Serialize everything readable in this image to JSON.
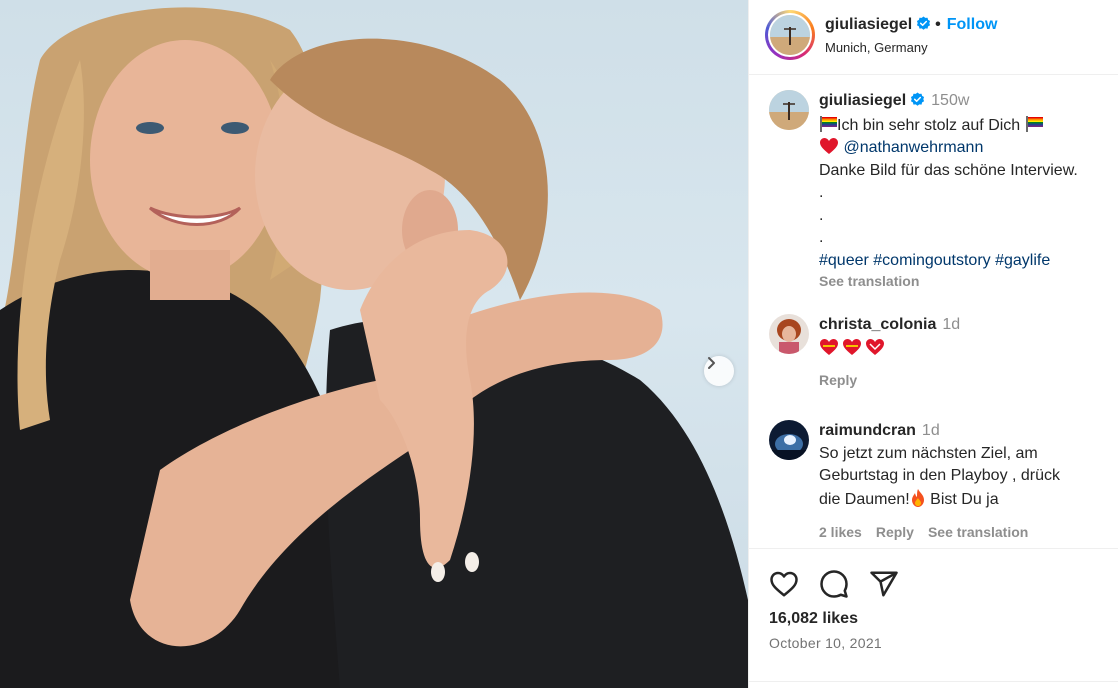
{
  "post": {
    "username": "giuliasiegel",
    "location": "Munich, Germany",
    "follow_label": "Follow",
    "separator": "•"
  },
  "caption": {
    "username": "giuliasiegel",
    "time": "150w",
    "line1": "Ich bin sehr stolz auf Dich",
    "mention": "@nathanwehrmann",
    "line3": "Danke Bild für das schöne Interview.",
    "dots": [
      ".",
      ".",
      "."
    ],
    "hashtags": "#queer #comingoutstory #gaylife",
    "see_translation": "See translation"
  },
  "comments": [
    {
      "username": "christa_colonia",
      "time": "1d",
      "reply_label": "Reply"
    },
    {
      "username": "raimundcran",
      "time": "1d",
      "text_lines": [
        "So jetzt zum nächsten Ziel, am",
        "Geburtstag in den Playboy , drück",
        "die Daumen!"
      ],
      "text_after_emoji": " Bist Du ja",
      "likes_label": "2 likes",
      "reply_label": "Reply",
      "translation_label": "See translation"
    }
  ],
  "engagement": {
    "likes": "16,082 likes",
    "date": "October 10, 2021"
  },
  "icons": {
    "verified": "verified-badge-icon",
    "next": "chevron-right-icon",
    "like": "heart-outline-icon",
    "comment": "comment-bubble-icon",
    "share": "paper-plane-icon"
  },
  "colors": {
    "link": "#00376b",
    "follow": "#0095f6",
    "verified": "#0095f6",
    "muted": "#8e8e8e"
  }
}
